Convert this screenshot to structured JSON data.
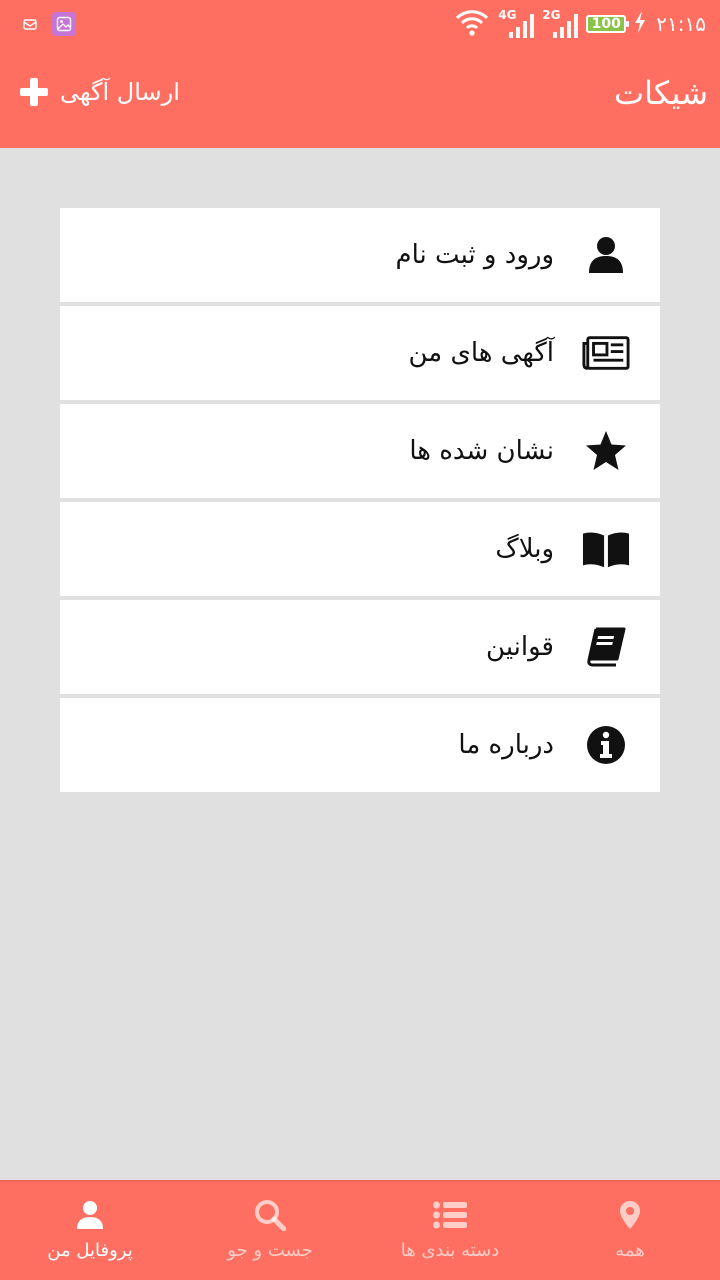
{
  "status_bar": {
    "time": "۲۱:۱۵",
    "battery": "100",
    "network_1": "4G",
    "network_2": "2G",
    "icons": [
      "mail-icon",
      "gallery-icon",
      "wifi-icon",
      "signal-icon",
      "battery-icon",
      "charging-icon"
    ]
  },
  "app_bar": {
    "title": "شیکات",
    "post_ad_label": "ارسال آگهی"
  },
  "menu": {
    "items": [
      {
        "label": "ورود و ثبت نام",
        "icon": "user-icon"
      },
      {
        "label": "آگهی های من",
        "icon": "newspaper-icon"
      },
      {
        "label": "نشان شده ها",
        "icon": "star-icon"
      },
      {
        "label": "وبلاگ",
        "icon": "open-book-icon"
      },
      {
        "label": "قوانین",
        "icon": "book-icon"
      },
      {
        "label": "درباره ما",
        "icon": "info-icon"
      }
    ]
  },
  "bottom_nav": {
    "items": [
      {
        "label": "پروفایل من",
        "icon": "user-icon",
        "active": true
      },
      {
        "label": "جست و جو",
        "icon": "search-icon",
        "active": false
      },
      {
        "label": "دسته بندی ها",
        "icon": "list-icon",
        "active": false
      },
      {
        "label": "همه",
        "icon": "location-pin-icon",
        "active": false
      }
    ]
  },
  "colors": {
    "primary": "#ff6f61",
    "background": "#e0e0e0",
    "card": "#ffffff",
    "text": "#111111",
    "battery": "#8bc34a"
  }
}
